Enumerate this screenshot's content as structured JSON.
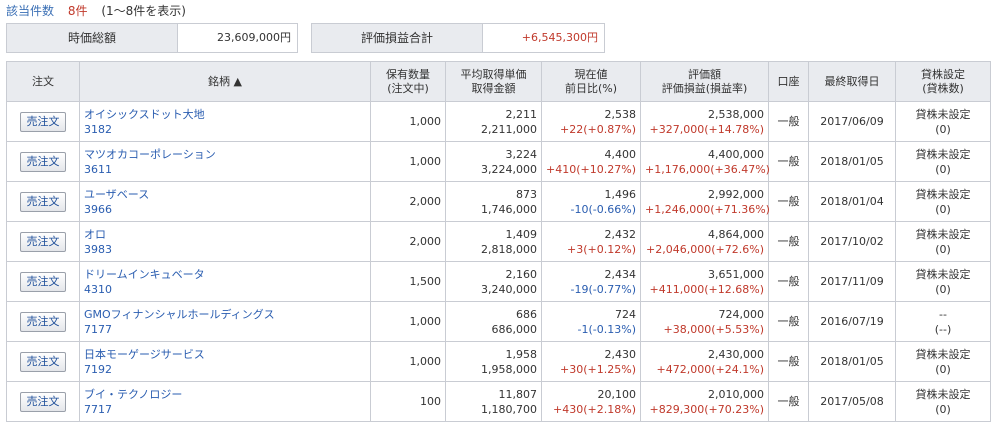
{
  "header": {
    "count_label": "該当件数",
    "count_value": "8件",
    "range_text": "(1～8件を表示)"
  },
  "summary": {
    "market_value_label": "時価総額",
    "market_value": "23,609,000円",
    "pl_label": "評価損益合計",
    "pl_value": "+6,545,300円"
  },
  "columns": {
    "order": "注文",
    "name": "銘柄 ▲",
    "qty1": "保有数量",
    "qty2": "(注文中)",
    "cost1": "平均取得単価",
    "cost2": "取得金額",
    "price1": "現在値",
    "price2": "前日比(%)",
    "val1": "評価額",
    "val2": "評価損益(損益率)",
    "account": "口座",
    "date": "最終取得日",
    "lend1": "貸株設定",
    "lend2": "(貸株数)"
  },
  "colors": {
    "up": "#c0392b",
    "down": "#2a5db0",
    "link": "#2a5db0"
  },
  "rows": [
    {
      "button": "売注文",
      "name": "オイシックスドット大地",
      "code": "3182",
      "qty": "1,000",
      "avg_cost": "2,211",
      "cost_total": "2,211,000",
      "price": "2,538",
      "change": "+22(+0.87%)",
      "change_dir": "up",
      "value": "2,538,000",
      "pl": "+327,000(+14.78%)",
      "account": "一般",
      "date": "2017/06/09",
      "lend1": "貸株未設定",
      "lend2": "(0)"
    },
    {
      "button": "売注文",
      "name": "マツオカコーポレーション",
      "code": "3611",
      "qty": "1,000",
      "avg_cost": "3,224",
      "cost_total": "3,224,000",
      "price": "4,400",
      "change": "+410(+10.27%)",
      "change_dir": "up",
      "value": "4,400,000",
      "pl": "+1,176,000(+36.47%)",
      "account": "一般",
      "date": "2018/01/05",
      "lend1": "貸株未設定",
      "lend2": "(0)"
    },
    {
      "button": "売注文",
      "name": "ユーザベース",
      "code": "3966",
      "qty": "2,000",
      "avg_cost": "873",
      "cost_total": "1,746,000",
      "price": "1,496",
      "change": "-10(-0.66%)",
      "change_dir": "down",
      "value": "2,992,000",
      "pl": "+1,246,000(+71.36%)",
      "account": "一般",
      "date": "2018/01/04",
      "lend1": "貸株未設定",
      "lend2": "(0)"
    },
    {
      "button": "売注文",
      "name": "オロ",
      "code": "3983",
      "qty": "2,000",
      "avg_cost": "1,409",
      "cost_total": "2,818,000",
      "price": "2,432",
      "change": "+3(+0.12%)",
      "change_dir": "up",
      "value": "4,864,000",
      "pl": "+2,046,000(+72.6%)",
      "account": "一般",
      "date": "2017/10/02",
      "lend1": "貸株未設定",
      "lend2": "(0)"
    },
    {
      "button": "売注文",
      "name": "ドリームインキュベータ",
      "code": "4310",
      "qty": "1,500",
      "avg_cost": "2,160",
      "cost_total": "3,240,000",
      "price": "2,434",
      "change": "-19(-0.77%)",
      "change_dir": "down",
      "value": "3,651,000",
      "pl": "+411,000(+12.68%)",
      "account": "一般",
      "date": "2017/11/09",
      "lend1": "貸株未設定",
      "lend2": "(0)"
    },
    {
      "button": "売注文",
      "name": "GMOフィナンシャルホールディングス",
      "code": "7177",
      "qty": "1,000",
      "avg_cost": "686",
      "cost_total": "686,000",
      "price": "724",
      "change": "-1(-0.13%)",
      "change_dir": "down",
      "value": "724,000",
      "pl": "+38,000(+5.53%)",
      "account": "一般",
      "date": "2016/07/19",
      "lend1": "--",
      "lend2": "(--)"
    },
    {
      "button": "売注文",
      "name": "日本モーゲージサービス",
      "code": "7192",
      "qty": "1,000",
      "avg_cost": "1,958",
      "cost_total": "1,958,000",
      "price": "2,430",
      "change": "+30(+1.25%)",
      "change_dir": "up",
      "value": "2,430,000",
      "pl": "+472,000(+24.1%)",
      "account": "一般",
      "date": "2018/01/05",
      "lend1": "貸株未設定",
      "lend2": "(0)"
    },
    {
      "button": "売注文",
      "name": "ブイ・テクノロジー",
      "code": "7717",
      "qty": "100",
      "avg_cost": "11,807",
      "cost_total": "1,180,700",
      "price": "20,100",
      "change": "+430(+2.18%)",
      "change_dir": "up",
      "value": "2,010,000",
      "pl": "+829,300(+70.23%)",
      "account": "一般",
      "date": "2017/05/08",
      "lend1": "貸株未設定",
      "lend2": "(0)"
    }
  ]
}
